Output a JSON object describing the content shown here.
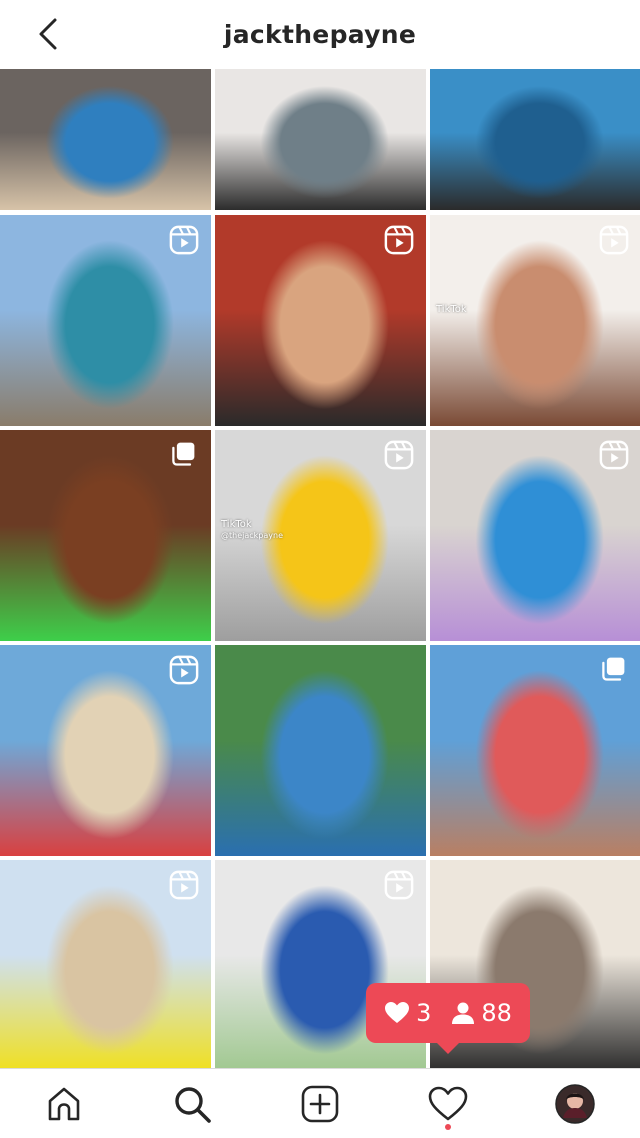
{
  "header": {
    "username": "jackthepayne",
    "back_icon": "chevron-left-icon"
  },
  "grid": {
    "tiles": [
      {
        "id": "post-1",
        "badge": "none",
        "colors": [
          "#6b6460",
          "#2f7fbf",
          "#d7c3a8"
        ]
      },
      {
        "id": "post-2",
        "badge": "none",
        "colors": [
          "#e9e6e4",
          "#6f7f88",
          "#2c2c2c"
        ]
      },
      {
        "id": "post-3",
        "badge": "none",
        "colors": [
          "#3a8fc7",
          "#1f5f8f",
          "#2b2b2b"
        ]
      },
      {
        "id": "post-4",
        "badge": "reel",
        "colors": [
          "#8db6e0",
          "#2e8ea6",
          "#8a7c6a"
        ]
      },
      {
        "id": "post-5",
        "badge": "reel",
        "colors": [
          "#b23a2a",
          "#d9a47f",
          "#2a2a2a"
        ]
      },
      {
        "id": "post-6",
        "badge": "reel",
        "colors": [
          "#f3efeb",
          "#c98d6f",
          "#7a4a35"
        ],
        "caption_top": "TikTok"
      },
      {
        "id": "post-7",
        "badge": "carousel",
        "colors": [
          "#6b3b24",
          "#7a3f22",
          "#3ecf4a"
        ]
      },
      {
        "id": "post-8",
        "badge": "reel",
        "colors": [
          "#d8d8d8",
          "#f5c518",
          "#9e9e9e"
        ],
        "caption_top": "TikTok",
        "caption_sub": "@thejackpayne"
      },
      {
        "id": "post-9",
        "badge": "reel",
        "colors": [
          "#d9d4d0",
          "#2f8fd6",
          "#b78fd6"
        ]
      },
      {
        "id": "post-10",
        "badge": "reel",
        "colors": [
          "#6ea9d9",
          "#e2d2b5",
          "#d94040"
        ]
      },
      {
        "id": "post-11",
        "badge": "none",
        "colors": [
          "#4a8a4a",
          "#3c86c8",
          "#2a6fb0"
        ]
      },
      {
        "id": "post-12",
        "badge": "carousel",
        "colors": [
          "#5fa0d8",
          "#e05a5a",
          "#b97f63"
        ]
      },
      {
        "id": "post-13",
        "badge": "reel",
        "colors": [
          "#cfe0f0",
          "#d9c4a2",
          "#f0e020"
        ]
      },
      {
        "id": "post-14",
        "badge": "reel",
        "colors": [
          "#e8e8e8",
          "#2a5bb0",
          "#a0c890"
        ]
      },
      {
        "id": "post-15",
        "badge": "none",
        "colors": [
          "#ede6dc",
          "#8b7a6d",
          "#2b2b2b"
        ]
      }
    ]
  },
  "activity_toast": {
    "likes_count": "3",
    "followers_count": "88",
    "like_icon": "heart-icon",
    "follower_icon": "person-icon",
    "color": "#ed4956"
  },
  "tabbar": {
    "tabs": [
      {
        "name": "home",
        "icon": "home-icon"
      },
      {
        "name": "search",
        "icon": "search-icon"
      },
      {
        "name": "create",
        "icon": "plus-square-icon"
      },
      {
        "name": "activity",
        "icon": "heart-icon"
      },
      {
        "name": "profile",
        "icon": "avatar"
      }
    ]
  }
}
